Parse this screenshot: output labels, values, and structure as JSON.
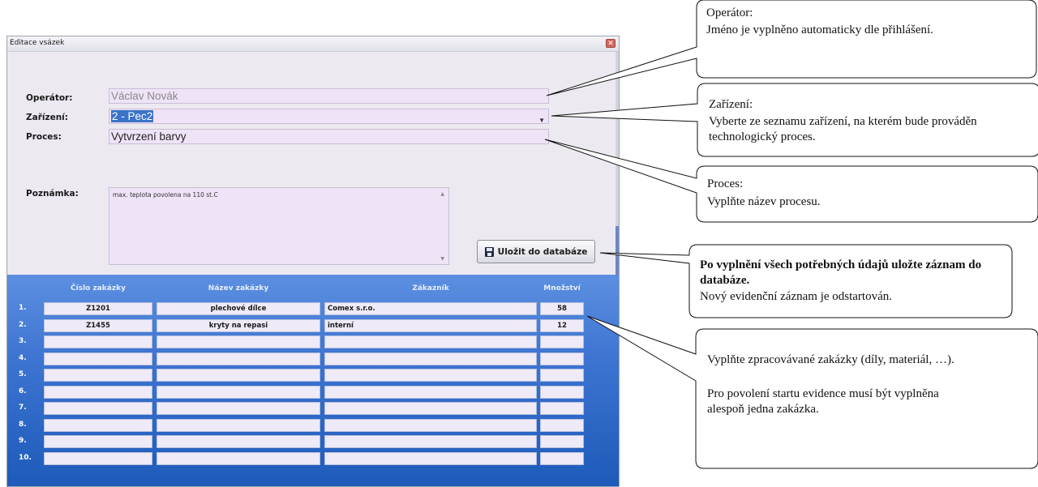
{
  "window": {
    "title": "Editace vsázek",
    "close_glyph": "✕"
  },
  "form": {
    "operator_label": "Operátor:",
    "operator_value": "Václav Novák",
    "device_label": "Zařízení:",
    "device_value": "2 - Pec2",
    "process_label": "Proces:",
    "process_value": "Vytvrzení barvy",
    "note_label": "Poznámka:",
    "note_value": "max. teplota povolena na 110 st.C",
    "save_label": "Uložit do databáze"
  },
  "grid": {
    "headers": [
      "Číslo zakázky",
      "Název zakázky",
      "Zákazník",
      "Množství"
    ],
    "rows": [
      {
        "num": "1.",
        "order": "Z1201",
        "name": "plechové dílce",
        "customer": "Comex s.r.o.",
        "qty": "58"
      },
      {
        "num": "2.",
        "order": "Z1455",
        "name": "kryty na repasi",
        "customer": "interní",
        "qty": "12"
      },
      {
        "num": "3.",
        "order": "",
        "name": "",
        "customer": "",
        "qty": ""
      },
      {
        "num": "4.",
        "order": "",
        "name": "",
        "customer": "",
        "qty": ""
      },
      {
        "num": "5.",
        "order": "",
        "name": "",
        "customer": "",
        "qty": ""
      },
      {
        "num": "6.",
        "order": "",
        "name": "",
        "customer": "",
        "qty": ""
      },
      {
        "num": "7.",
        "order": "",
        "name": "",
        "customer": "",
        "qty": ""
      },
      {
        "num": "8.",
        "order": "",
        "name": "",
        "customer": "",
        "qty": ""
      },
      {
        "num": "9.",
        "order": "",
        "name": "",
        "customer": "",
        "qty": ""
      },
      {
        "num": "10.",
        "order": "",
        "name": "",
        "customer": "",
        "qty": ""
      }
    ]
  },
  "callouts": {
    "operator": {
      "title": "Operátor:",
      "text": "Jméno je vyplněno automaticky dle přihlášení."
    },
    "device": {
      "title": "Zařízení:",
      "text": "Vyberte ze seznamu zařízení, na kterém bude prováděn technologický proces."
    },
    "process": {
      "title": "Proces:",
      "text": "Vyplňte název procesu."
    },
    "save": {
      "bold": "Po vyplnění všech potřebných údajů uložte záznam do databáze.",
      "text": "Nový evidenční záznam je odstartován."
    },
    "orders": {
      "text1": "Vyplňte zpracovávané zakázky (díly, materiál, …).",
      "text2": "Pro povolení startu evidence musí být vyplněna alespoň jedna zakázka."
    }
  },
  "colors": {
    "field_bg": "#efe3f7",
    "grid_top": "#5c8fe0",
    "grid_bottom": "#1d5ab9",
    "selection": "#3a73c8"
  }
}
